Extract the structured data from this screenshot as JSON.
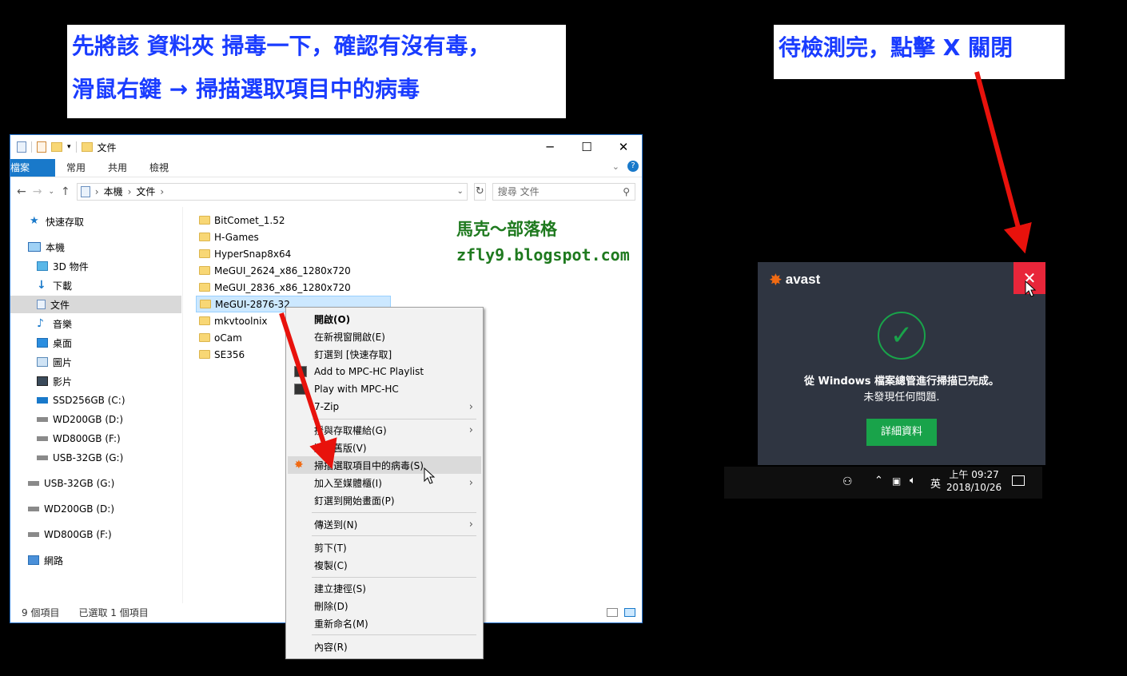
{
  "callouts": {
    "left_line1": "先將該 資料夾 掃毒一下，確認有沒有毒，",
    "left_line2": "滑鼠右鍵 → 掃描選取項目中的病毒",
    "right": "待檢測完，點擊 X 關閉"
  },
  "explorer": {
    "title": "文件",
    "ribbon_tabs": [
      "檔案",
      "常用",
      "共用",
      "檢視"
    ],
    "address": [
      "本機",
      "文件"
    ],
    "search_placeholder": "搜尋 文件",
    "nav": [
      "快速存取",
      "本機",
      "3D 物件",
      "下載",
      "文件",
      "音樂",
      "桌面",
      "圖片",
      "影片",
      "SSD256GB (C:)",
      "WD200GB (D:)",
      "WD800GB (F:)",
      "USB-32GB (G:)",
      "USB-32GB (G:)",
      "WD200GB (D:)",
      "WD800GB (F:)",
      "網路"
    ],
    "files": [
      "BitComet_1.52",
      "H-Games",
      "HyperSnap8x64",
      "MeGUI_2624_x86_1280x720",
      "MeGUI_2836_x86_1280x720",
      "MeGUI-2876-32",
      "mkvtoolnix",
      "oCam",
      "SE356"
    ],
    "status_count": "9 個項目",
    "status_selected": "已選取 1 個項目"
  },
  "blog": {
    "name": "馬克～部落格",
    "url": "zfly9.blogspot.com"
  },
  "context_menu": [
    "開啟(O)",
    "在新視窗開啟(E)",
    "釘選到 [快速存取]",
    "Add to MPC-HC Playlist",
    "Play with MPC-HC",
    "7-Zip",
    "授與存取權給(G)",
    "還原舊版(V)",
    "掃描選取項目中的病毒(S)",
    "加入至媒體櫃(I)",
    "釘選到開始畫面(P)",
    "傳送到(N)",
    "剪下(T)",
    "複製(C)",
    "建立捷徑(S)",
    "刪除(D)",
    "重新命名(M)",
    "內容(R)"
  ],
  "avast": {
    "brand": "avast",
    "line1": "從 Windows 檔案總管進行掃描已完成。",
    "line2": "未發現任何問題.",
    "button": "詳細資料",
    "close": "✕"
  },
  "taskbar": {
    "ime": "英",
    "time": "上午 09:27",
    "date": "2018/10/26"
  },
  "colors": {
    "arrow": "#e8120c",
    "avast_green": "#19a34a",
    "avast_close": "#e8263a",
    "callout_text": "#1a3cff"
  }
}
